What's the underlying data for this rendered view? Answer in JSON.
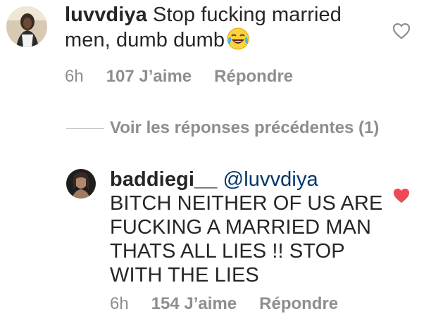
{
  "comment1": {
    "username": "luvvdiya",
    "text_line1": "Stop fucking married",
    "text_line2": "men, dumb dumb",
    "emoji": "😂",
    "time": "6h",
    "likes": "107 J’aime",
    "reply": "Répondre",
    "liked": false
  },
  "view_replies": {
    "label": "Voir les réponses précédentes (1)"
  },
  "comment2": {
    "username": "baddiegi__",
    "mention": "@luvvdiya",
    "lines": [
      "BITCH NEITHER OF US ARE",
      "FUCKING A MARRIED MAN",
      "THATS ALL LIES !! STOP",
      "WITH THE LIES"
    ],
    "time": "6h",
    "likes": "154 J’aime",
    "reply": "Répondre",
    "liked": true
  },
  "colors": {
    "text": "#262626",
    "meta": "#8e8e8e",
    "mention": "#003569",
    "heart_liked": "#ed4956",
    "heart_outline": "#8e8e8e"
  }
}
